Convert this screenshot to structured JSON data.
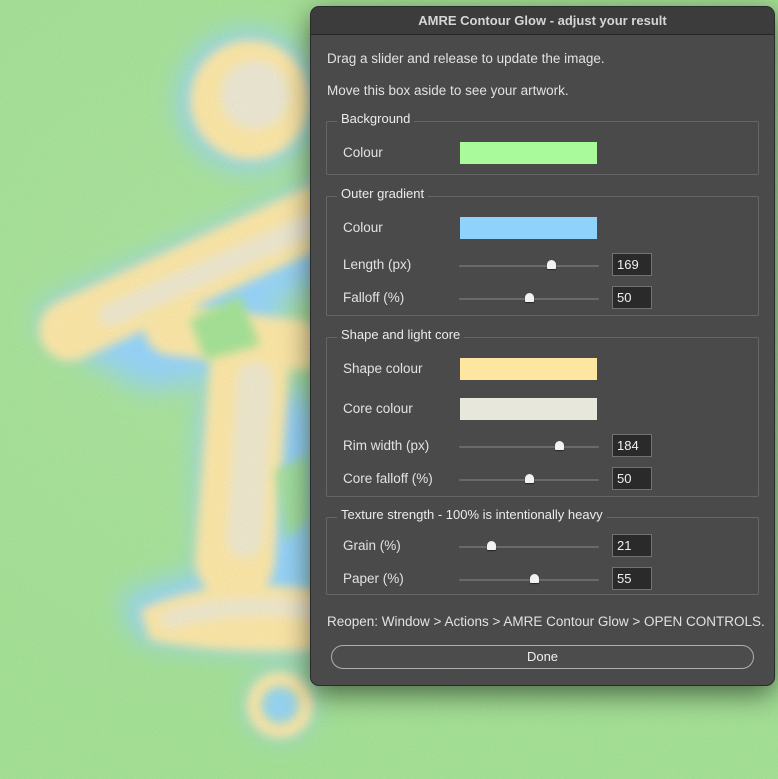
{
  "dialog": {
    "title": "AMRE Contour Glow - adjust your result",
    "instruction_1": "Drag a slider and release to update the image.",
    "instruction_2": "Move this box aside to see your artwork.",
    "reopen_text": "Reopen: Window > Actions > AMRE Contour Glow > OPEN CONTROLS.",
    "done_label": "Done"
  },
  "background": {
    "title": "Background",
    "colour_label": "Colour",
    "colour": "#a8fa9a"
  },
  "outer_gradient": {
    "title": "Outer gradient",
    "colour_label": "Colour",
    "colour": "#8fd2fb",
    "length_label": "Length (px)",
    "length_value": "169",
    "length_fraction": 0.66,
    "falloff_label": "Falloff (%)",
    "falloff_value": "50",
    "falloff_fraction": 0.5
  },
  "shape_core": {
    "title": "Shape and light core",
    "shape_colour_label": "Shape colour",
    "shape_colour": "#fde6a0",
    "core_colour_label": "Core colour",
    "core_colour": "#e7e7dc",
    "rim_label": "Rim width (px)",
    "rim_value": "184",
    "rim_fraction": 0.72,
    "core_falloff_label": "Core falloff (%)",
    "core_falloff_value": "50",
    "core_falloff_fraction": 0.5
  },
  "texture": {
    "title": "Texture strength - 100% is intentionally heavy",
    "grain_label": "Grain (%)",
    "grain_value": "21",
    "grain_fraction": 0.23,
    "paper_label": "Paper (%)",
    "paper_value": "55",
    "paper_fraction": 0.54
  },
  "artwork": {
    "glow_colour": "#8fd2fb",
    "shape_colour": "#fde6a0",
    "core_colour": "#e7e7dc",
    "background_colour": "#9fe18f"
  }
}
